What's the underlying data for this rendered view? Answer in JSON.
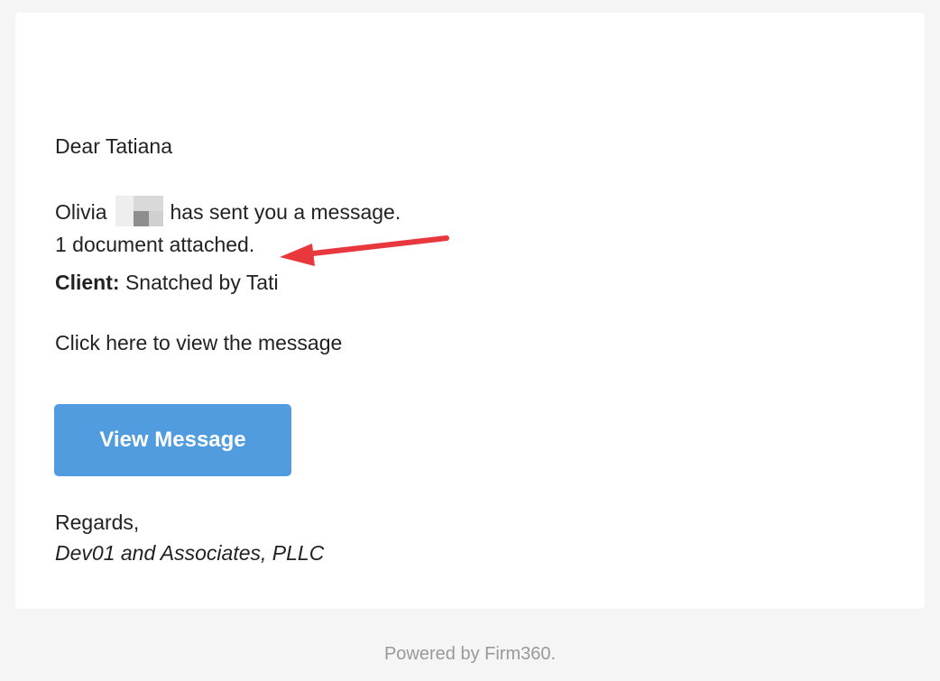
{
  "email": {
    "greeting": "Dear Tatiana",
    "sender_name": "Olivia",
    "sender_message": "has sent you a message.",
    "attachment_text": "1 document attached.",
    "client_label": "Client:",
    "client_name": "Snatched by Tati",
    "click_instruction": "Click here to view the message",
    "view_button_label": "View Message",
    "closing": "Regards,",
    "firm_name": "Dev01 and Associates, PLLC"
  },
  "annotation": {
    "arrow_color": "#e8383d"
  },
  "footer": {
    "powered_by": "Powered by Firm360."
  },
  "colors": {
    "button": "#519cde",
    "page_background": "#f5f5f5",
    "card_background": "#ffffff",
    "footer_text": "#999999"
  }
}
